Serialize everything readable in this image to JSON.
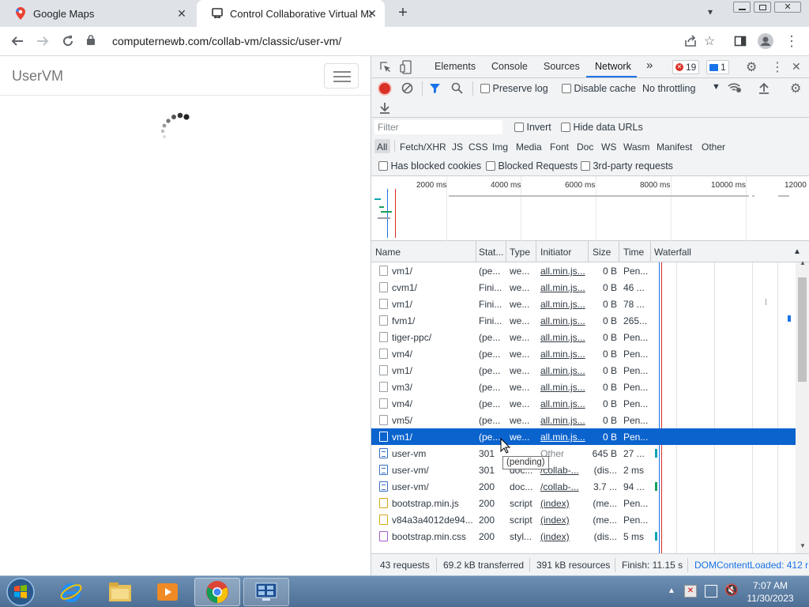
{
  "browser": {
    "tabs": [
      {
        "label": "Google Maps",
        "icon": "google-maps-pin-icon"
      },
      {
        "label": "Control Collaborative Virtual Mac",
        "icon": "collabvm-icon"
      }
    ],
    "new_tab_icon": "plus-icon",
    "url": "computernewb.com/collab-vm/classic/user-vm/"
  },
  "page": {
    "brand": "UserVM"
  },
  "devtools": {
    "tabs": [
      "Elements",
      "Console",
      "Sources",
      "Network"
    ],
    "more_tabs": "»",
    "error_count": "19",
    "message_count": "1",
    "toolbar": {
      "preserve_log": "Preserve log",
      "disable_cache": "Disable cache",
      "throttling": "No throttling"
    },
    "filter_placeholder": "Filter",
    "invert": "Invert",
    "hide_data_urls": "Hide data URLs",
    "type_filters": [
      "All",
      "Fetch/XHR",
      "JS",
      "CSS",
      "Img",
      "Media",
      "Font",
      "Doc",
      "WS",
      "Wasm",
      "Manifest",
      "Other"
    ],
    "blocked_filters": [
      "Has blocked cookies",
      "Blocked Requests",
      "3rd-party requests"
    ],
    "timeline_ticks": [
      "2000 ms",
      "4000 ms",
      "6000 ms",
      "8000 ms",
      "10000 ms",
      "12000"
    ],
    "columns": [
      "Name",
      "Stat...",
      "Type",
      "Initiator",
      "Size",
      "Time",
      "Waterfall"
    ],
    "rows": [
      {
        "name": "vm1/",
        "status": "(pe...",
        "type": "we...",
        "initiator": "all.min.js...",
        "size": "0 B",
        "time": "Pen...",
        "icon": "blank"
      },
      {
        "name": "cvm1/",
        "status": "Fini...",
        "type": "we...",
        "initiator": "all.min.js...",
        "size": "0 B",
        "time": "46 ...",
        "icon": "blank"
      },
      {
        "name": "vm1/",
        "status": "Fini...",
        "type": "we...",
        "initiator": "all.min.js...",
        "size": "0 B",
        "time": "78 ...",
        "icon": "blank"
      },
      {
        "name": "fvm1/",
        "status": "Fini...",
        "type": "we...",
        "initiator": "all.min.js...",
        "size": "0 B",
        "time": "265...",
        "icon": "blank"
      },
      {
        "name": "tiger-ppc/",
        "status": "(pe...",
        "type": "we...",
        "initiator": "all.min.js...",
        "size": "0 B",
        "time": "Pen...",
        "icon": "blank"
      },
      {
        "name": "vm4/",
        "status": "(pe...",
        "type": "we...",
        "initiator": "all.min.js...",
        "size": "0 B",
        "time": "Pen...",
        "icon": "blank"
      },
      {
        "name": "vm1/",
        "status": "(pe...",
        "type": "we...",
        "initiator": "all.min.js...",
        "size": "0 B",
        "time": "Pen...",
        "icon": "blank"
      },
      {
        "name": "vm3/",
        "status": "(pe...",
        "type": "we...",
        "initiator": "all.min.js...",
        "size": "0 B",
        "time": "Pen...",
        "icon": "blank"
      },
      {
        "name": "vm4/",
        "status": "(pe...",
        "type": "we...",
        "initiator": "all.min.js...",
        "size": "0 B",
        "time": "Pen...",
        "icon": "blank"
      },
      {
        "name": "vm5/",
        "status": "(pe...",
        "type": "we...",
        "initiator": "all.min.js...",
        "size": "0 B",
        "time": "Pen...",
        "icon": "blank"
      },
      {
        "name": "vm1/",
        "status": "(pe...",
        "type": "we...",
        "initiator": "all.min.js...",
        "size": "0 B",
        "time": "Pen...",
        "icon": "blank",
        "selected": true
      },
      {
        "name": "user-vm",
        "status": "301",
        "type": "",
        "initiator": "Other",
        "size": "645 B",
        "time": "27 ...",
        "icon": "doc"
      },
      {
        "name": "user-vm/",
        "status": "301",
        "type": "doc...",
        "initiator": "/collab-...",
        "size": "(dis...",
        "time": "2 ms",
        "icon": "doc"
      },
      {
        "name": "user-vm/",
        "status": "200",
        "type": "doc...",
        "initiator": "/collab-...",
        "size": "3.7 ...",
        "time": "94 ...",
        "icon": "doc"
      },
      {
        "name": "bootstrap.min.js",
        "status": "200",
        "type": "script",
        "initiator": "(index)",
        "size": "(me...",
        "time": "Pen...",
        "icon": "script"
      },
      {
        "name": "v84a3a4012de94...",
        "status": "200",
        "type": "script",
        "initiator": "(index)",
        "size": "(me...",
        "time": "Pen...",
        "icon": "script"
      },
      {
        "name": "bootstrap.min.css",
        "status": "200",
        "type": "styl...",
        "initiator": "(index)",
        "size": "(dis...",
        "time": "5 ms",
        "icon": "css"
      }
    ],
    "tooltip": "(pending)",
    "status": {
      "requests": "43 requests",
      "transferred": "69.2 kB transferred",
      "resources": "391 kB resources",
      "finish": "Finish: 11.15 s",
      "dom": "DOMContentLoaded: 412 r"
    }
  },
  "taskbar": {
    "time": "7:07 AM",
    "date": "11/30/2023"
  },
  "colors": {
    "selection": "#0b63ce",
    "record": "#d93025",
    "accent": "#1a73e8"
  }
}
